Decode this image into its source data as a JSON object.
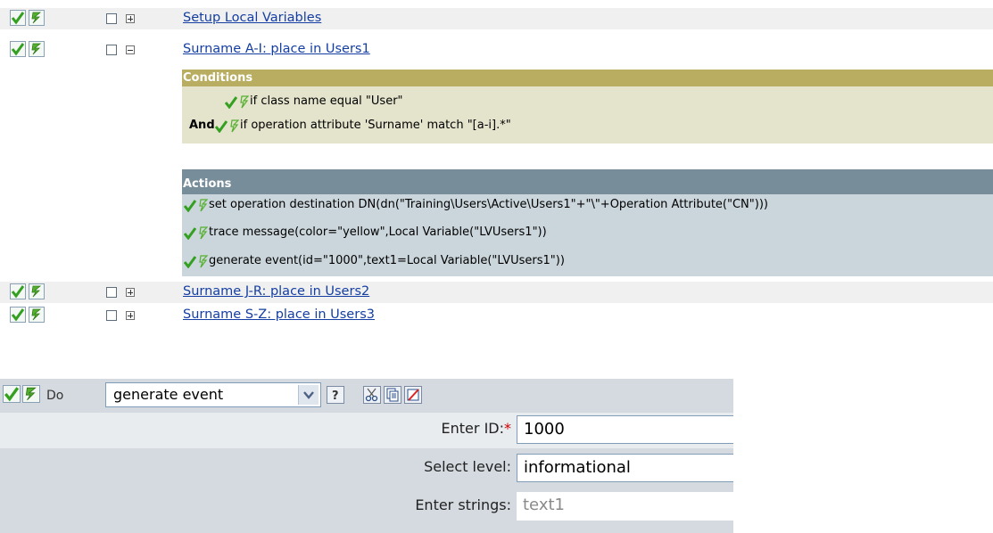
{
  "colors": {
    "link": "#143ea2",
    "conditions_header": "#b9ad61",
    "conditions_body": "#e4e3cc",
    "actions_header": "#788d9a",
    "actions_body": "#cbd6dc",
    "enabled_check": "#33a020",
    "required_asterisk": "#cc0000"
  },
  "icons": {
    "enabled": "check-icon",
    "trace": "lightning-bolt-icon",
    "expand": "plus-box-icon",
    "collapse": "minus-box-icon",
    "help": "question-mark-icon",
    "cut": "scissors-icon",
    "copy": "copy-icon",
    "delete": "delete-icon",
    "dropdown": "chevron-down-icon"
  },
  "rules": [
    {
      "label": "Setup Local Variables",
      "expanded": false
    },
    {
      "label": "Surname A-I: place in Users1",
      "expanded": true
    },
    {
      "label": "Surname J-R: place in Users2",
      "expanded": false
    },
    {
      "label": "Surname S-Z: place in Users3",
      "expanded": false
    }
  ],
  "conditions": {
    "header": "Conditions",
    "items": [
      {
        "prefix": "",
        "text": "if class name equal \"User\""
      },
      {
        "prefix": "And",
        "text": "if operation attribute 'Surname' match \"[a-i].*\""
      }
    ]
  },
  "actions": {
    "header": "Actions",
    "items": [
      {
        "text": "set operation destination DN(dn(\"Training\\Users\\Active\\Users1\"+\"\\\"+Operation Attribute(\"CN\")))"
      },
      {
        "text": "trace message(color=\"yellow\",Local Variable(\"LVUsers1\"))"
      },
      {
        "text": "generate event(id=\"1000\",text1=Local Variable(\"LVUsers1\"))"
      }
    ]
  },
  "editor": {
    "do_label": "Do",
    "selected_action": "generate event",
    "fields": [
      {
        "label": "Enter ID:",
        "required": "*",
        "value": "1000",
        "placeholder": ""
      },
      {
        "label": "Select level:",
        "required": "",
        "value": "informational",
        "placeholder": ""
      },
      {
        "label": "Enter strings:",
        "required": "",
        "value": "",
        "placeholder": "text1"
      }
    ]
  }
}
